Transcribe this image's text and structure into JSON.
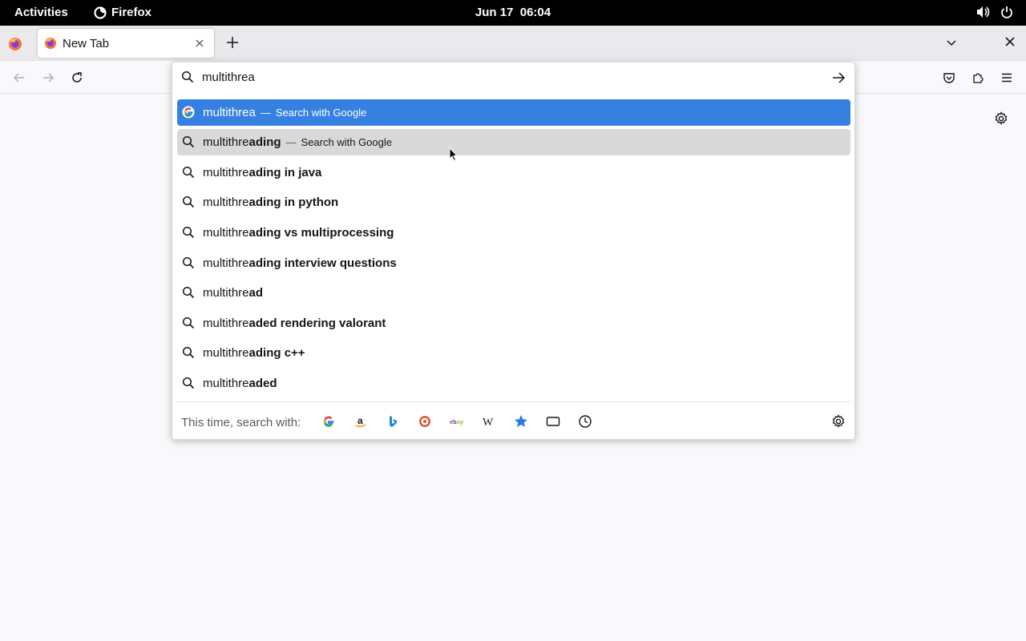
{
  "topbar": {
    "activities": "Activities",
    "app_name": "Firefox",
    "date": "Jun 17",
    "time": "06:04"
  },
  "tabs": [
    {
      "title": "New Tab",
      "active": true
    }
  ],
  "urlbar": {
    "value": "multithrea",
    "search_label": "Search with Google"
  },
  "suggestions": [
    {
      "typed": "multithrea",
      "completion": "",
      "action": "Search with Google",
      "icon": "google-icon",
      "selected": true
    },
    {
      "typed": "multithre",
      "completion": "ading",
      "action": "Search with Google",
      "icon": "search-icon",
      "hovered": true
    },
    {
      "typed": "multithre",
      "completion": "ading in java",
      "icon": "search-icon"
    },
    {
      "typed": "multithre",
      "completion": "ading in python",
      "icon": "search-icon"
    },
    {
      "typed": "multithre",
      "completion": "ading vs multiprocessing",
      "icon": "search-icon"
    },
    {
      "typed": "multithre",
      "completion": "ading interview questions",
      "icon": "search-icon"
    },
    {
      "typed": "multithre",
      "completion": "ad",
      "icon": "search-icon"
    },
    {
      "typed": "multithre",
      "completion": "aded rendering valorant",
      "icon": "search-icon"
    },
    {
      "typed": "multithre",
      "completion": "ading c++",
      "icon": "search-icon"
    },
    {
      "typed": "multithre",
      "completion": "aded",
      "icon": "search-icon"
    }
  ],
  "separator": "—",
  "one_off": {
    "label": "This time, search with:",
    "engines": [
      "Google",
      "Amazon",
      "Bing",
      "DuckDuckGo",
      "eBay",
      "Wikipedia",
      "Bookmarks",
      "Tabs",
      "History"
    ]
  },
  "colors": {
    "selected_row": "#3680e2",
    "hover_row": "#d9d9d9",
    "topbar": "#000000"
  }
}
